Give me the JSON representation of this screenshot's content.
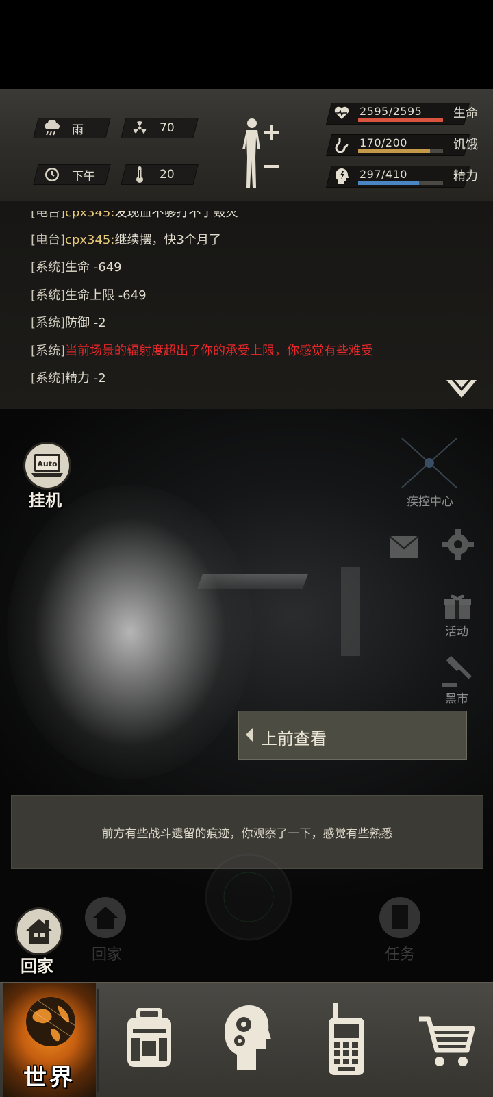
{
  "status": {
    "weather": "雨",
    "radiation": "70",
    "time_of_day": "下午",
    "temperature": "20",
    "health": {
      "value": "2595/2595",
      "label": "生命",
      "fraction": 1.0,
      "color": "#d9543e"
    },
    "hunger": {
      "value": "170/200",
      "label": "饥饿",
      "fraction": 0.85,
      "color": "#c49a4a"
    },
    "energy": {
      "value": "297/410",
      "label": "精力",
      "fraction": 0.72,
      "color": "#4a86c4"
    }
  },
  "chat": {
    "lines": [
      {
        "tag": "[电台]",
        "who": "cpx345:",
        "text": "发现血不够打不了毁灭",
        "style": "msg"
      },
      {
        "tag": "[电台]",
        "who": "cpx345:",
        "text": "继续摆，快3个月了",
        "style": "msg"
      },
      {
        "tag": "[系统]",
        "who": "",
        "text": "生命 -649",
        "style": "msg"
      },
      {
        "tag": "[系统]",
        "who": "",
        "text": "生命上限 -649",
        "style": "msg"
      },
      {
        "tag": "[系统]",
        "who": "",
        "text": "防御 -2",
        "style": "msg"
      },
      {
        "tag": "[系统]",
        "who": "",
        "text": "当前场景的辐射度超出了你的承受上限，你感觉有些难受",
        "style": "warn"
      },
      {
        "tag": "[系统]",
        "who": "",
        "text": "精力 -2",
        "style": "msg"
      }
    ]
  },
  "scene": {
    "auto_label": "挂机",
    "auto_badge": "Auto",
    "control_center": "疾控中心",
    "activity": "活动",
    "black_market": "黑市",
    "action": "上前查看",
    "description": "前方有些战斗遗留的痕迹，你观察了一下，感觉有些熟悉",
    "home": "回家",
    "home_ghost": "回家",
    "task_ghost": "任务"
  },
  "nav": {
    "world": "世界"
  }
}
